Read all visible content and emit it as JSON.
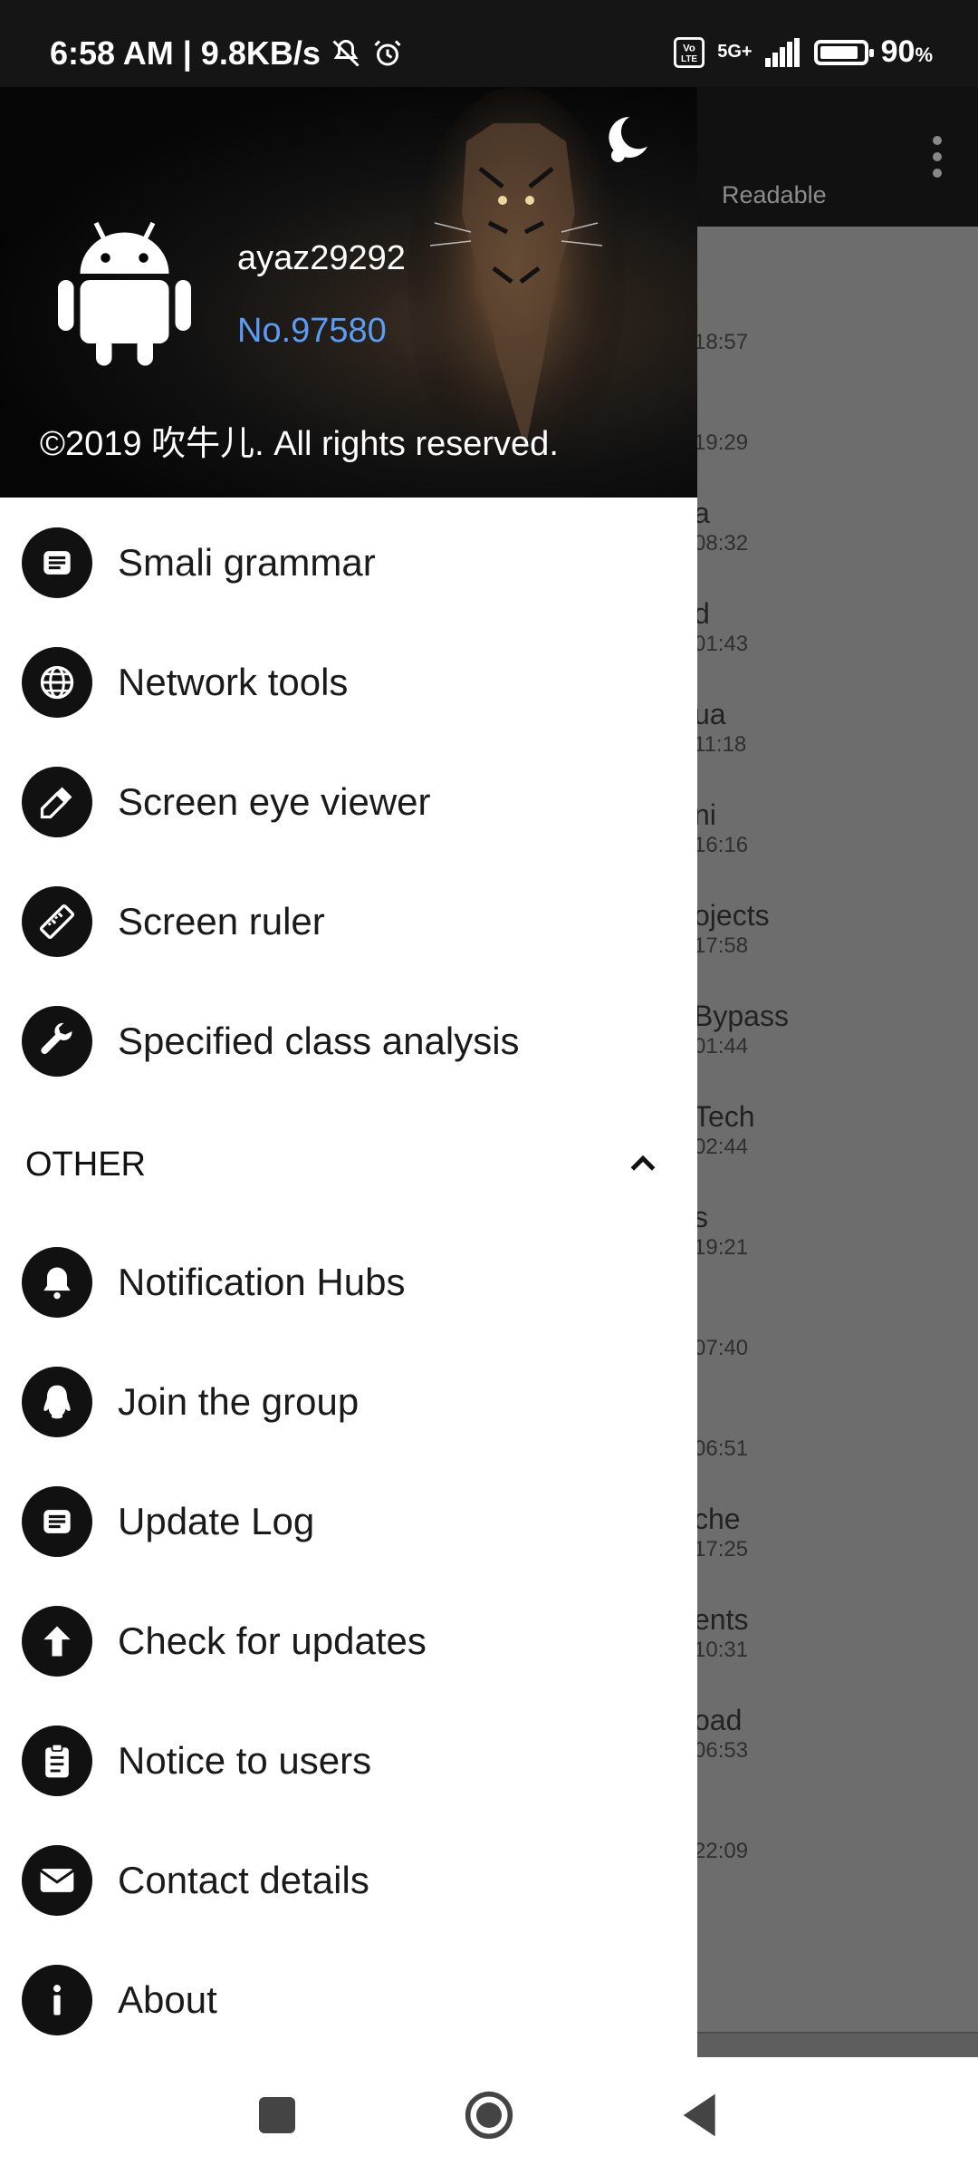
{
  "status_bar": {
    "time": "6:58 AM",
    "speed": "9.8KB/s",
    "network": "5G+",
    "volte": "Vo LTE",
    "battery_level": 90,
    "battery_text": "90",
    "battery_unit": "%"
  },
  "background_app": {
    "tab_label": "Readable",
    "rows": [
      {
        "title": "",
        "date": "18:57"
      },
      {
        "title": "",
        "date": "19:29"
      },
      {
        "title": "a",
        "date": "08:32"
      },
      {
        "title": "d",
        "date": "01:43"
      },
      {
        "title": "ua",
        "date": "11:18"
      },
      {
        "title": "ni",
        "date": "16:16"
      },
      {
        "title": "ojects",
        "date": "17:58"
      },
      {
        "title": "Bypass",
        "date": "01:44"
      },
      {
        "title": "Tech",
        "date": "02:44"
      },
      {
        "title": "s",
        "date": "19:21"
      },
      {
        "title": "",
        "date": "07:40"
      },
      {
        "title": "",
        "date": "06:51"
      },
      {
        "title": "che",
        "date": "17:25"
      },
      {
        "title": "ents",
        "date": "10:31"
      },
      {
        "title": "oad",
        "date": "06:53"
      },
      {
        "title": "",
        "date": "22:09"
      }
    ]
  },
  "drawer": {
    "username": "ayaz29292",
    "user_no": "No.97580",
    "copyright": "©2019 吹牛儿. All rights reserved.",
    "tools": [
      {
        "label": "Smali grammar",
        "icon": "smali-icon"
      },
      {
        "label": "Network tools",
        "icon": "globe-icon"
      },
      {
        "label": "Screen eye viewer",
        "icon": "eyedropper-icon"
      },
      {
        "label": "Screen ruler",
        "icon": "ruler-icon"
      },
      {
        "label": "Specified class analysis",
        "icon": "wrench-icon"
      }
    ],
    "other_section": "OTHER",
    "other": [
      {
        "label": "Notification Hubs",
        "icon": "bell-icon"
      },
      {
        "label": "Join the group",
        "icon": "qq-penguin-icon"
      },
      {
        "label": "Update Log",
        "icon": "log-icon"
      },
      {
        "label": "Check for updates",
        "icon": "arrow-up-icon"
      },
      {
        "label": "Notice to users",
        "icon": "clipboard-icon"
      },
      {
        "label": "Contact details",
        "icon": "mail-icon"
      },
      {
        "label": "About",
        "icon": "info-icon"
      }
    ]
  }
}
